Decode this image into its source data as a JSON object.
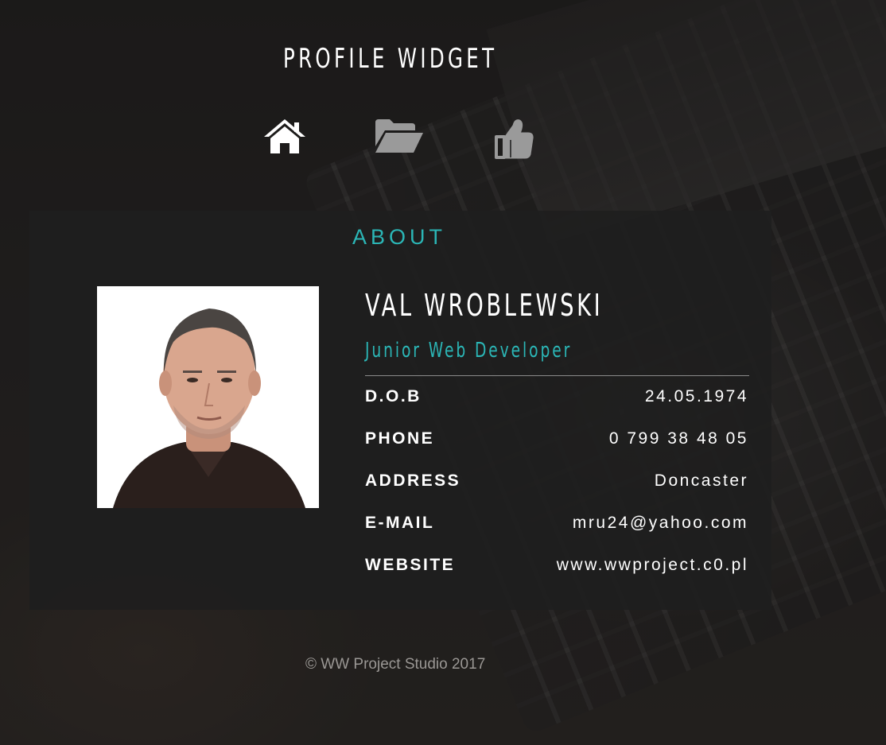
{
  "header": {
    "title": "PROFILE WIDGET"
  },
  "nav": {
    "items": [
      {
        "icon": "home-icon",
        "active": true,
        "color": "#ffffff"
      },
      {
        "icon": "folder-open-icon",
        "active": false,
        "color": "#9a9a9a"
      },
      {
        "icon": "thumbs-up-icon",
        "active": false,
        "color": "#9a9a9a"
      }
    ]
  },
  "about": {
    "section_title": "ABOUT",
    "name": "VAL WROBLEWSKI",
    "role": "Junior Web Developer",
    "details": [
      {
        "label": "D.O.B",
        "value": "24.05.1974"
      },
      {
        "label": "PHONE",
        "value": "0 799 38 48 05"
      },
      {
        "label": "ADDRESS",
        "value": "Doncaster"
      },
      {
        "label": "E-MAIL",
        "value": "mru24@yahoo.com"
      },
      {
        "label": "WEBSITE",
        "value": "www.wwproject.c0.pl"
      }
    ]
  },
  "footer": {
    "copyright": "© WW Project Studio 2017"
  },
  "colors": {
    "accent": "#2bb6b6",
    "text": "#ffffff",
    "muted": "#9a9794",
    "card_bg": "#1e1e1e"
  }
}
